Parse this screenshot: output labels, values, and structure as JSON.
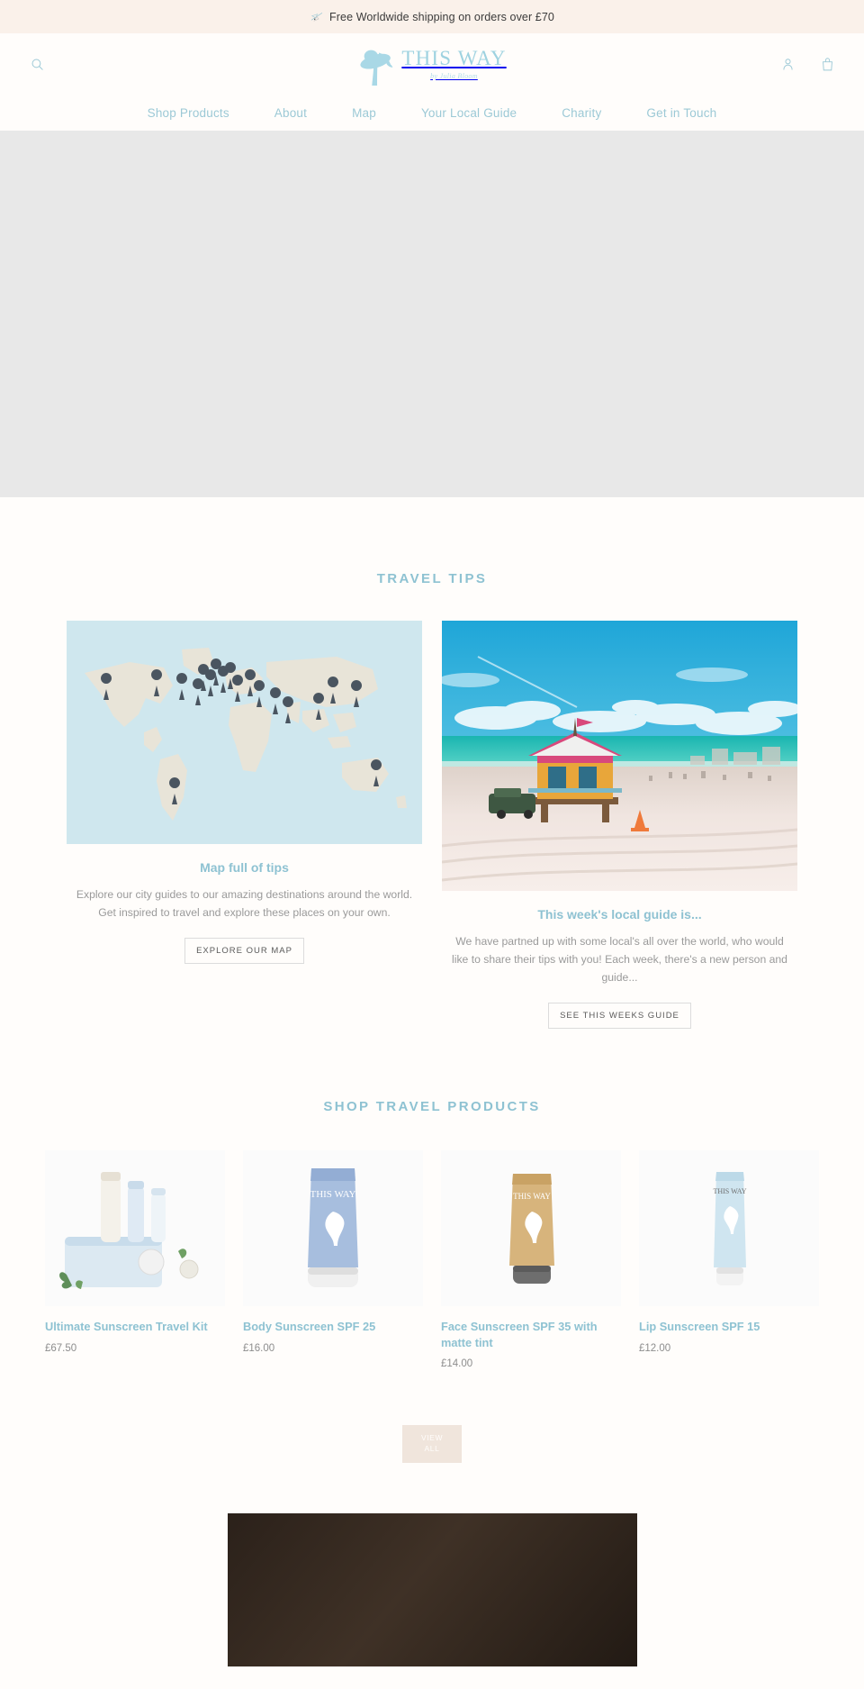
{
  "announcement": {
    "icon": "airplane-icon",
    "text": "Free Worldwide shipping on orders over £70"
  },
  "header": {
    "search_icon": "search-icon",
    "account_icon": "account-icon",
    "cart_icon": "shopping-bag-icon",
    "logo": {
      "mark": "woman-in-sunhat-icon",
      "title": "THIS WAY",
      "subtitle": "by Julia Bloom"
    },
    "nav": [
      {
        "label": "Shop Products"
      },
      {
        "label": "About"
      },
      {
        "label": "Map"
      },
      {
        "label": "Your Local Guide"
      },
      {
        "label": "Charity"
      },
      {
        "label": "Get in Touch"
      }
    ]
  },
  "hero": {
    "placeholder": ""
  },
  "travel_tips": {
    "title": "TRAVEL TIPS",
    "cards": [
      {
        "image": "world-map-with-pins",
        "heading": "Map full of tips",
        "body": "Explore our city guides to our amazing destinations around the world. Get inspired to travel and explore these places on your own.",
        "button": "EXPLORE OUR MAP"
      },
      {
        "image": "miami-beach-lifeguard-tower-photo",
        "heading": "This week's local guide is...",
        "body": "We have partned up with some local's all over the world, who would like to share their tips with you! Each week, there's a new person and guide...",
        "button": "SEE THIS WEEKS GUIDE"
      }
    ]
  },
  "shop": {
    "title": "SHOP TRAVEL PRODUCTS",
    "products": [
      {
        "name": "Ultimate Sunscreen Travel Kit",
        "price": "£67.50",
        "image": "sunscreen-travel-kit-photo"
      },
      {
        "name": "Body Sunscreen SPF 25",
        "price": "£16.00",
        "image": "body-sunscreen-tube-photo"
      },
      {
        "name": "Face Sunscreen SPF 35 with matte tint",
        "price": "£14.00",
        "image": "face-sunscreen-tube-photo"
      },
      {
        "name": "Lip Sunscreen SPF 15",
        "price": "£12.00",
        "image": "lip-sunscreen-tube-photo"
      }
    ],
    "view_all_line1": "VIEW",
    "view_all_line2": "ALL"
  },
  "colors": {
    "brand_blue": "#8ec2d2",
    "nav_blue": "#9cc9d6",
    "announce_bg": "#faf1ea",
    "page_bg": "#fffdfb",
    "hero_bg": "#e8e8e8",
    "button_beige": "#f0e5dc",
    "map_sea": "#cfe7ee",
    "map_land": "#ece8dd"
  }
}
